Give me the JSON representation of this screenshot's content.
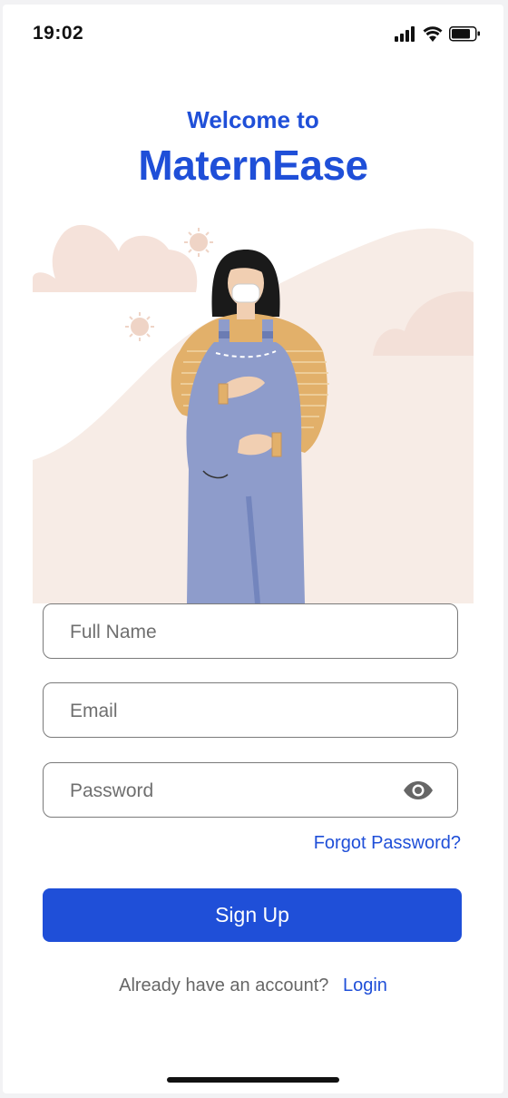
{
  "status_bar": {
    "time": "19:02"
  },
  "header": {
    "welcome": "Welcome to",
    "app_name": "MaternEase"
  },
  "form": {
    "full_name": {
      "placeholder": "Full Name",
      "value": ""
    },
    "email": {
      "placeholder": "Email",
      "value": ""
    },
    "password": {
      "placeholder": "Password",
      "value": ""
    },
    "forgot_password": "Forgot Password?",
    "submit": "Sign Up"
  },
  "footer": {
    "question": "Already have an account?",
    "login": "Login"
  },
  "icons": {
    "visibility": "eye-icon",
    "signal": "signal-icon",
    "wifi": "wifi-icon",
    "battery": "battery-icon"
  },
  "colors": {
    "brand": "#1f4fd8",
    "overall": "#8e9ccb",
    "sweater": "#e2b06a",
    "background_blob": "#f7ece6"
  }
}
